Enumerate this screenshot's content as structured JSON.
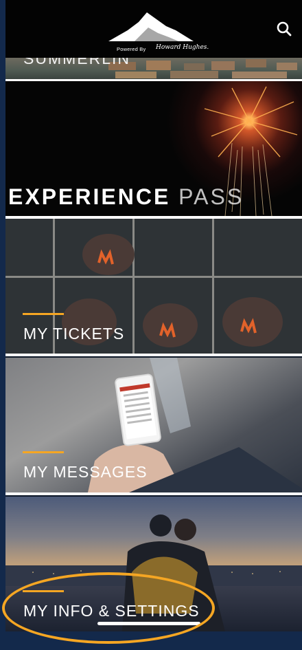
{
  "header": {
    "powered_by": "Powered By",
    "signature": "Howard Hughes."
  },
  "tiles": {
    "community_label": "SUMMERLIN",
    "experience": {
      "bold": "EXPERIENCE",
      "light": "PASS"
    },
    "tickets": "MY TICKETS",
    "messages": "MY MESSAGES",
    "settings": "MY INFO & SETTINGS"
  },
  "colors": {
    "accent": "#f5a623",
    "background": "#13294b",
    "header": "#030303"
  }
}
